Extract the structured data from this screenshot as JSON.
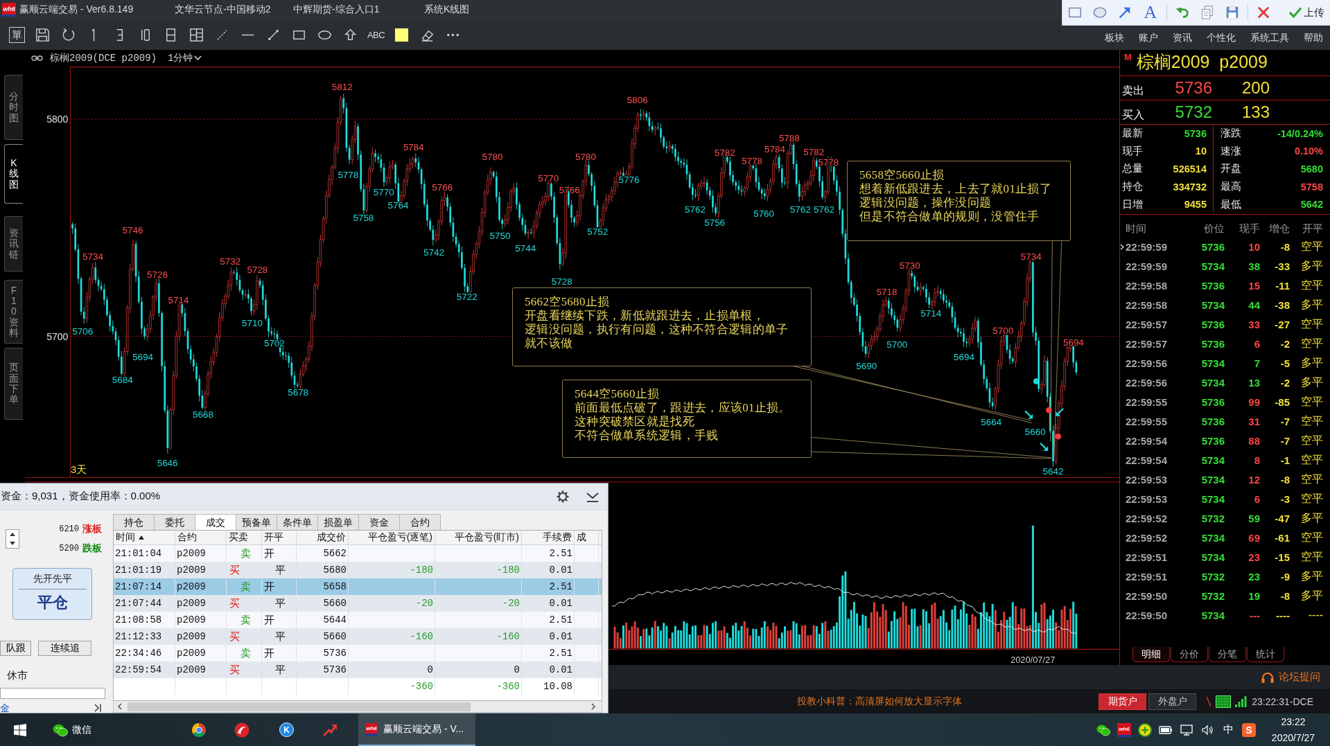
{
  "window": {
    "logo": "wh6",
    "title": "赢顺云端交易 - Ver6.8.149",
    "items": [
      "文华云节点-中国移动2",
      "中辉期货-综合入口1",
      "系统K线图"
    ]
  },
  "drawing_toolbar": {
    "text_tool": "A",
    "upload": "上传"
  },
  "toolbar": {
    "order_tool": "單",
    "text_tool": "ABC",
    "menu": [
      "板块",
      "账户",
      "资讯",
      "个性化",
      "系统工具",
      "帮助"
    ]
  },
  "side_tabs": [
    {
      "label": "分时图",
      "selected": false
    },
    {
      "label": "K线图",
      "selected": true
    },
    {
      "label": "资讯链",
      "selected": false
    },
    {
      "label": "F10资料",
      "selected": false
    },
    {
      "label": "页面下单",
      "selected": false
    }
  ],
  "chart": {
    "symbol": "棕榈2009(DCE p2009)",
    "period": "1分钟",
    "y_labels": [
      "5800",
      "5700"
    ],
    "range_label": "3天",
    "price_labels": [
      {
        "text": "5706",
        "kind": "low"
      },
      {
        "text": "5734",
        "kind": "high"
      },
      {
        "text": "5684",
        "kind": "low"
      },
      {
        "text": "5746",
        "kind": "high"
      },
      {
        "text": "5694",
        "kind": "low"
      },
      {
        "text": "5726",
        "kind": "high"
      },
      {
        "text": "5646",
        "kind": "low"
      },
      {
        "text": "5714",
        "kind": "high"
      },
      {
        "text": "5668",
        "kind": "low"
      },
      {
        "text": "5732",
        "kind": "high"
      },
      {
        "text": "5710",
        "kind": "low"
      },
      {
        "text": "5728",
        "kind": "high"
      },
      {
        "text": "5702",
        "kind": "low"
      },
      {
        "text": "5678",
        "kind": "low"
      },
      {
        "text": "5812",
        "kind": "high"
      },
      {
        "text": "5778",
        "kind": "low"
      },
      {
        "text": "5758",
        "kind": "low"
      },
      {
        "text": "5770",
        "kind": "low"
      },
      {
        "text": "5764",
        "kind": "low"
      },
      {
        "text": "5784",
        "kind": "high"
      },
      {
        "text": "5742",
        "kind": "low"
      },
      {
        "text": "5766",
        "kind": "high"
      },
      {
        "text": "5722",
        "kind": "low"
      },
      {
        "text": "5780",
        "kind": "high"
      },
      {
        "text": "5750",
        "kind": "low"
      },
      {
        "text": "5744",
        "kind": "low"
      },
      {
        "text": "5770",
        "kind": "high"
      },
      {
        "text": "5728",
        "kind": "low"
      },
      {
        "text": "5766",
        "kind": "high"
      },
      {
        "text": "5780",
        "kind": "high"
      },
      {
        "text": "5752",
        "kind": "low"
      },
      {
        "text": "5776",
        "kind": "low"
      },
      {
        "text": "5806",
        "kind": "high"
      },
      {
        "text": "5762",
        "kind": "low"
      },
      {
        "text": "5756",
        "kind": "low"
      },
      {
        "text": "5782",
        "kind": "high"
      },
      {
        "text": "5778",
        "kind": "high"
      },
      {
        "text": "5760",
        "kind": "low"
      },
      {
        "text": "5784",
        "kind": "high"
      },
      {
        "text": "5788",
        "kind": "high"
      },
      {
        "text": "5762",
        "kind": "low"
      },
      {
        "text": "5782",
        "kind": "high"
      },
      {
        "text": "5762",
        "kind": "low"
      },
      {
        "text": "5778",
        "kind": "high"
      },
      {
        "text": "5690",
        "kind": "low"
      },
      {
        "text": "5718",
        "kind": "high"
      },
      {
        "text": "5700",
        "kind": "low"
      },
      {
        "text": "5730",
        "kind": "high"
      },
      {
        "text": "5714",
        "kind": "low"
      },
      {
        "text": "5694",
        "kind": "low"
      },
      {
        "text": "5664",
        "kind": "low"
      },
      {
        "text": "5700",
        "kind": "high"
      },
      {
        "text": "5734",
        "kind": "high"
      },
      {
        "text": "5660",
        "kind": "low"
      },
      {
        "text": "5642",
        "kind": "low"
      },
      {
        "text": "5694",
        "kind": "high"
      }
    ],
    "annotations": [
      {
        "lines": [
          "5658空5660止损",
          "想着新低跟进去，上去了就01止损了",
          "逻辑没问题，操作没问题",
          "但是不符合做单的规则，没管住手"
        ]
      },
      {
        "lines": [
          "5662空5680止损",
          "开盘看继续下跌，新低就跟进去，止损单根，",
          "逻辑没问题，执行有问题，这种不符合逻辑的单子",
          "就不该做"
        ]
      },
      {
        "lines": [
          "5644空5660止损",
          "前面最低点破了，跟进去，应该01止损。",
          "这种突破禁区就是找死",
          "不符合做单系统逻辑，手贱"
        ]
      }
    ],
    "date": "2020/07/27"
  },
  "quote": {
    "flag": "M",
    "title": "棕榈2009  p2009",
    "sell": {
      "label": "卖出",
      "price": "5736",
      "volume": "200"
    },
    "buy": {
      "label": "买入",
      "price": "5732",
      "volume": "133"
    },
    "stats": [
      {
        "label": "最新",
        "value": "5736",
        "color": "#33e033"
      },
      {
        "label": "涨跌",
        "value": "-14/0.24%",
        "color": "#33e033"
      },
      {
        "label": "现手",
        "value": "10",
        "color": "#f3e23a"
      },
      {
        "label": "速涨",
        "value": "0.10%",
        "color": "#ff4646"
      },
      {
        "label": "总量",
        "value": "526514",
        "color": "#f3e23a"
      },
      {
        "label": "开盘",
        "value": "5680",
        "color": "#33e033"
      },
      {
        "label": "持仓",
        "value": "334732",
        "color": "#f3e23a"
      },
      {
        "label": "最高",
        "value": "5758",
        "color": "#ff4646"
      },
      {
        "label": "日增",
        "value": "9455",
        "color": "#f3e23a"
      },
      {
        "label": "最低",
        "value": "5642",
        "color": "#33e033"
      }
    ],
    "ticks": {
      "columns": [
        "时间",
        "价位",
        "现手",
        "增仓",
        "开平"
      ],
      "rows": [
        {
          "time": "22:59:59",
          "price": "5736",
          "volume": "10",
          "change": "-8",
          "type": "空平",
          "color": "#ff4646",
          "selected": true
        },
        {
          "time": "22:59:59",
          "price": "5734",
          "volume": "38",
          "change": "-33",
          "type": "多平",
          "color": "#33e033",
          "selected": false
        },
        {
          "time": "22:59:58",
          "price": "5736",
          "volume": "15",
          "change": "-11",
          "type": "空平",
          "color": "#ff4646",
          "selected": false
        },
        {
          "time": "22:59:58",
          "price": "5734",
          "volume": "44",
          "change": "-38",
          "type": "多平",
          "color": "#33e033",
          "selected": false
        },
        {
          "time": "22:59:57",
          "price": "5736",
          "volume": "33",
          "change": "-27",
          "type": "空平",
          "color": "#ff4646",
          "selected": false
        },
        {
          "time": "22:59:57",
          "price": "5736",
          "volume": "6",
          "change": "-2",
          "type": "空平",
          "color": "#ff4646",
          "selected": false
        },
        {
          "time": "22:59:56",
          "price": "5734",
          "volume": "7",
          "change": "-5",
          "type": "多平",
          "color": "#33e033",
          "selected": false
        },
        {
          "time": "22:59:56",
          "price": "5734",
          "volume": "13",
          "change": "-2",
          "type": "多平",
          "color": "#33e033",
          "selected": false
        },
        {
          "time": "22:59:55",
          "price": "5736",
          "volume": "99",
          "change": "-85",
          "type": "空平",
          "color": "#ff4646",
          "selected": false
        },
        {
          "time": "22:59:55",
          "price": "5736",
          "volume": "31",
          "change": "-7",
          "type": "空平",
          "color": "#ff4646",
          "selected": false
        },
        {
          "time": "22:59:54",
          "price": "5736",
          "volume": "88",
          "change": "-7",
          "type": "空平",
          "color": "#ff4646",
          "selected": false
        },
        {
          "time": "22:59:54",
          "price": "5734",
          "volume": "8",
          "change": "-1",
          "type": "空平",
          "color": "#ff4646",
          "selected": false
        },
        {
          "time": "22:59:53",
          "price": "5734",
          "volume": "12",
          "change": "-8",
          "type": "空平",
          "color": "#ff4646",
          "selected": false
        },
        {
          "time": "22:59:53",
          "price": "5734",
          "volume": "6",
          "change": "-3",
          "type": "空平",
          "color": "#ff4646",
          "selected": false
        },
        {
          "time": "22:59:52",
          "price": "5732",
          "volume": "59",
          "change": "-47",
          "type": "多平",
          "color": "#33e033",
          "selected": false
        },
        {
          "time": "22:59:52",
          "price": "5734",
          "volume": "69",
          "change": "-61",
          "type": "空平",
          "color": "#ff4646",
          "selected": false
        },
        {
          "time": "22:59:51",
          "price": "5734",
          "volume": "23",
          "change": "-15",
          "type": "空平",
          "color": "#ff4646",
          "selected": false
        },
        {
          "time": "22:59:51",
          "price": "5732",
          "volume": "23",
          "change": "-9",
          "type": "多平",
          "color": "#33e033",
          "selected": false
        },
        {
          "time": "22:59:50",
          "price": "5732",
          "volume": "19",
          "change": "-8",
          "type": "多平",
          "color": "#33e033",
          "selected": false
        },
        {
          "time": "22:59:50",
          "price": "5734",
          "volume": "---",
          "change": "----",
          "type": "----",
          "color": "#ff4646",
          "selected": false
        }
      ]
    },
    "tabs": [
      {
        "label": "明细",
        "selected": true
      },
      {
        "label": "分价",
        "selected": false
      },
      {
        "label": "分笔",
        "selected": false
      },
      {
        "label": "统计",
        "selected": false
      }
    ]
  },
  "trade_panel": {
    "summary": "资金：9,031，资金使用率：0.00%",
    "limits": [
      {
        "price": "6210",
        "label": "涨板",
        "kind": "up"
      },
      {
        "price": "5290",
        "label": "跌板",
        "kind": "down"
      }
    ],
    "mode_button": {
      "title": "先开先平",
      "action": "平仓"
    },
    "buttons": [
      "队跟",
      "连续追"
    ],
    "market_status": "休市",
    "deposit_link": "金",
    "tabs": [
      {
        "label": "持仓",
        "selected": false
      },
      {
        "label": "委托",
        "selected": false
      },
      {
        "label": "成交",
        "selected": true
      },
      {
        "label": "预备单",
        "selected": false
      },
      {
        "label": "条件单",
        "selected": false
      },
      {
        "label": "损盈单",
        "selected": false
      },
      {
        "label": "资金",
        "selected": false
      },
      {
        "label": "合约",
        "selected": false
      }
    ],
    "table": {
      "columns": [
        {
          "label": "时间",
          "sorted": true
        },
        {
          "label": "合约",
          "sorted": false
        },
        {
          "label": "买卖",
          "sorted": false
        },
        {
          "label": "开平",
          "sorted": false
        },
        {
          "label": "成交价",
          "sorted": false
        },
        {
          "label": "平仓盈亏(逐笔)",
          "sorted": false
        },
        {
          "label": "平仓盈亏(盯市)",
          "sorted": false
        },
        {
          "label": "手续费",
          "sorted": false
        },
        {
          "label": "成",
          "sorted": false
        }
      ],
      "rows": [
        {
          "time": "21:01:04",
          "contract": "p2009",
          "side": "卖",
          "open_close": "开",
          "price": "5662",
          "fee": "2.51",
          "kind": "open",
          "selected": false
        },
        {
          "time": "21:01:19",
          "contract": "p2009",
          "side": "买",
          "open_close": "平",
          "price": "5680",
          "pnl_trade": "-180",
          "pnl_mark": "-180",
          "color": "#2a9a2a",
          "fee": "0.01",
          "kind": "close",
          "selected": false
        },
        {
          "time": "21:07:14",
          "contract": "p2009",
          "side": "卖",
          "open_close": "开",
          "price": "5658",
          "fee": "2.51",
          "kind": "open",
          "selected": true
        },
        {
          "time": "21:07:44",
          "contract": "p2009",
          "side": "买",
          "open_close": "平",
          "price": "5660",
          "pnl_trade": "-20",
          "pnl_mark": "-20",
          "color": "#2a9a2a",
          "fee": "0.01",
          "kind": "close",
          "selected": false
        },
        {
          "time": "21:08:58",
          "contract": "p2009",
          "side": "卖",
          "open_close": "开",
          "price": "5644",
          "fee": "2.51",
          "kind": "open",
          "selected": false
        },
        {
          "time": "21:12:33",
          "contract": "p2009",
          "side": "买",
          "open_close": "平",
          "price": "5660",
          "pnl_trade": "-160",
          "pnl_mark": "-160",
          "color": "#2a9a2a",
          "fee": "0.01",
          "kind": "close",
          "selected": false
        },
        {
          "time": "22:34:46",
          "contract": "p2009",
          "side": "卖",
          "open_close": "开",
          "price": "5736",
          "fee": "2.51",
          "kind": "open",
          "selected": false
        },
        {
          "time": "22:59:54",
          "contract": "p2009",
          "side": "买",
          "open_close": "平",
          "price": "5736",
          "pnl_trade": "0",
          "pnl_mark": "0",
          "color": "#111111",
          "fee": "0.01",
          "kind": "close",
          "selected": false
        }
      ],
      "total": {
        "pnl_trade": "-360",
        "pnl_mark": "-360",
        "color": "#2a9a2a",
        "fee": "10.08"
      }
    }
  },
  "forum_link": "论坛提问",
  "status_bar": {
    "tip": "投教小科普：高清屏如何放大显示字体",
    "accounts": [
      {
        "label": "期货户",
        "selected": true
      },
      {
        "label": "外盘户",
        "selected": false
      }
    ],
    "clock": "23:22:31-DCE"
  },
  "taskbar": {
    "wechat_label": "微信",
    "app_glyph": "K",
    "active_app": {
      "logo": "wh6",
      "label": "赢顺云端交易 - V..."
    },
    "tray_logo": "wh6",
    "ime": "中",
    "input_glyph": "S",
    "time": "23:22",
    "date": "2020/7/27"
  }
}
